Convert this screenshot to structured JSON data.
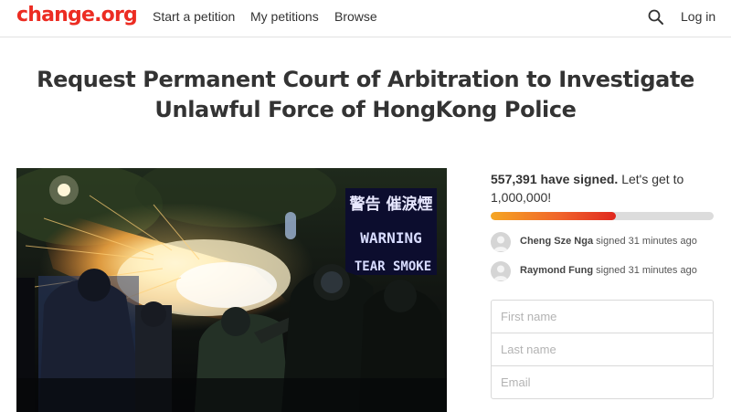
{
  "header": {
    "logo": "change.org",
    "nav": [
      {
        "label": "Start a petition"
      },
      {
        "label": "My petitions"
      },
      {
        "label": "Browse"
      }
    ],
    "search_icon": "search-icon",
    "login_label": "Log in"
  },
  "petition": {
    "title": "Request Permanent Court of Arbitration to Investigate Unlawful Force of HongKong Police",
    "image": {
      "sign_chinese": "警告 催淚煙",
      "sign_warning": "WARNING",
      "sign_tear_smoke": "TEAR SMOKE"
    }
  },
  "signatures": {
    "count": "557,391 have signed.",
    "goal_text": "Let's get to 1,000,000!",
    "progress_fraction": 0.56
  },
  "recent_signers": [
    {
      "name": "Cheng Sze Nga",
      "when": "signed 31 minutes ago"
    },
    {
      "name": "Raymond Fung",
      "when": "signed 31 minutes ago"
    }
  ],
  "form": {
    "first_name_placeholder": "First name",
    "last_name_placeholder": "Last name",
    "email_placeholder": "Email"
  },
  "colors": {
    "brand": "#ec2c22",
    "progress_start": "#f5a623",
    "progress_end": "#e0281f"
  }
}
